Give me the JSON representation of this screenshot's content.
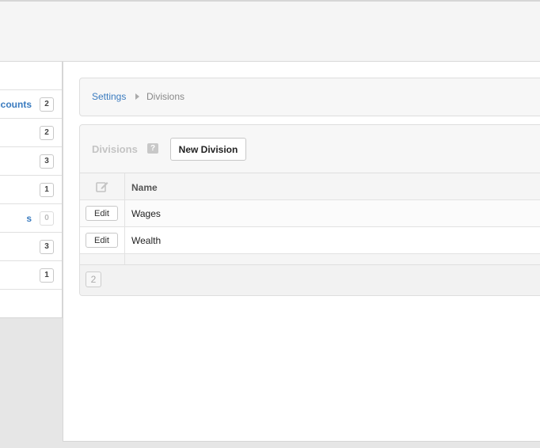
{
  "sidebar": {
    "items": [
      {
        "label": "Accounts",
        "count": "2"
      },
      {
        "label": "",
        "count": "2"
      },
      {
        "label": "",
        "count": "3"
      },
      {
        "label": "",
        "count": "1"
      },
      {
        "label": "s",
        "count": "0"
      },
      {
        "label": "",
        "count": "3"
      },
      {
        "label": "",
        "count": "1"
      }
    ]
  },
  "breadcrumb": {
    "root": "Settings",
    "current": "Divisions"
  },
  "panel": {
    "title": "Divisions",
    "help_icon": "?",
    "new_button": "New Division",
    "columns": {
      "edit_icon": "edit-icon",
      "name": "Name"
    },
    "rows": [
      {
        "edit_label": "Edit",
        "name": "Wages"
      },
      {
        "edit_label": "Edit",
        "name": "Wealth"
      }
    ],
    "pager": {
      "current_page": "2"
    }
  }
}
